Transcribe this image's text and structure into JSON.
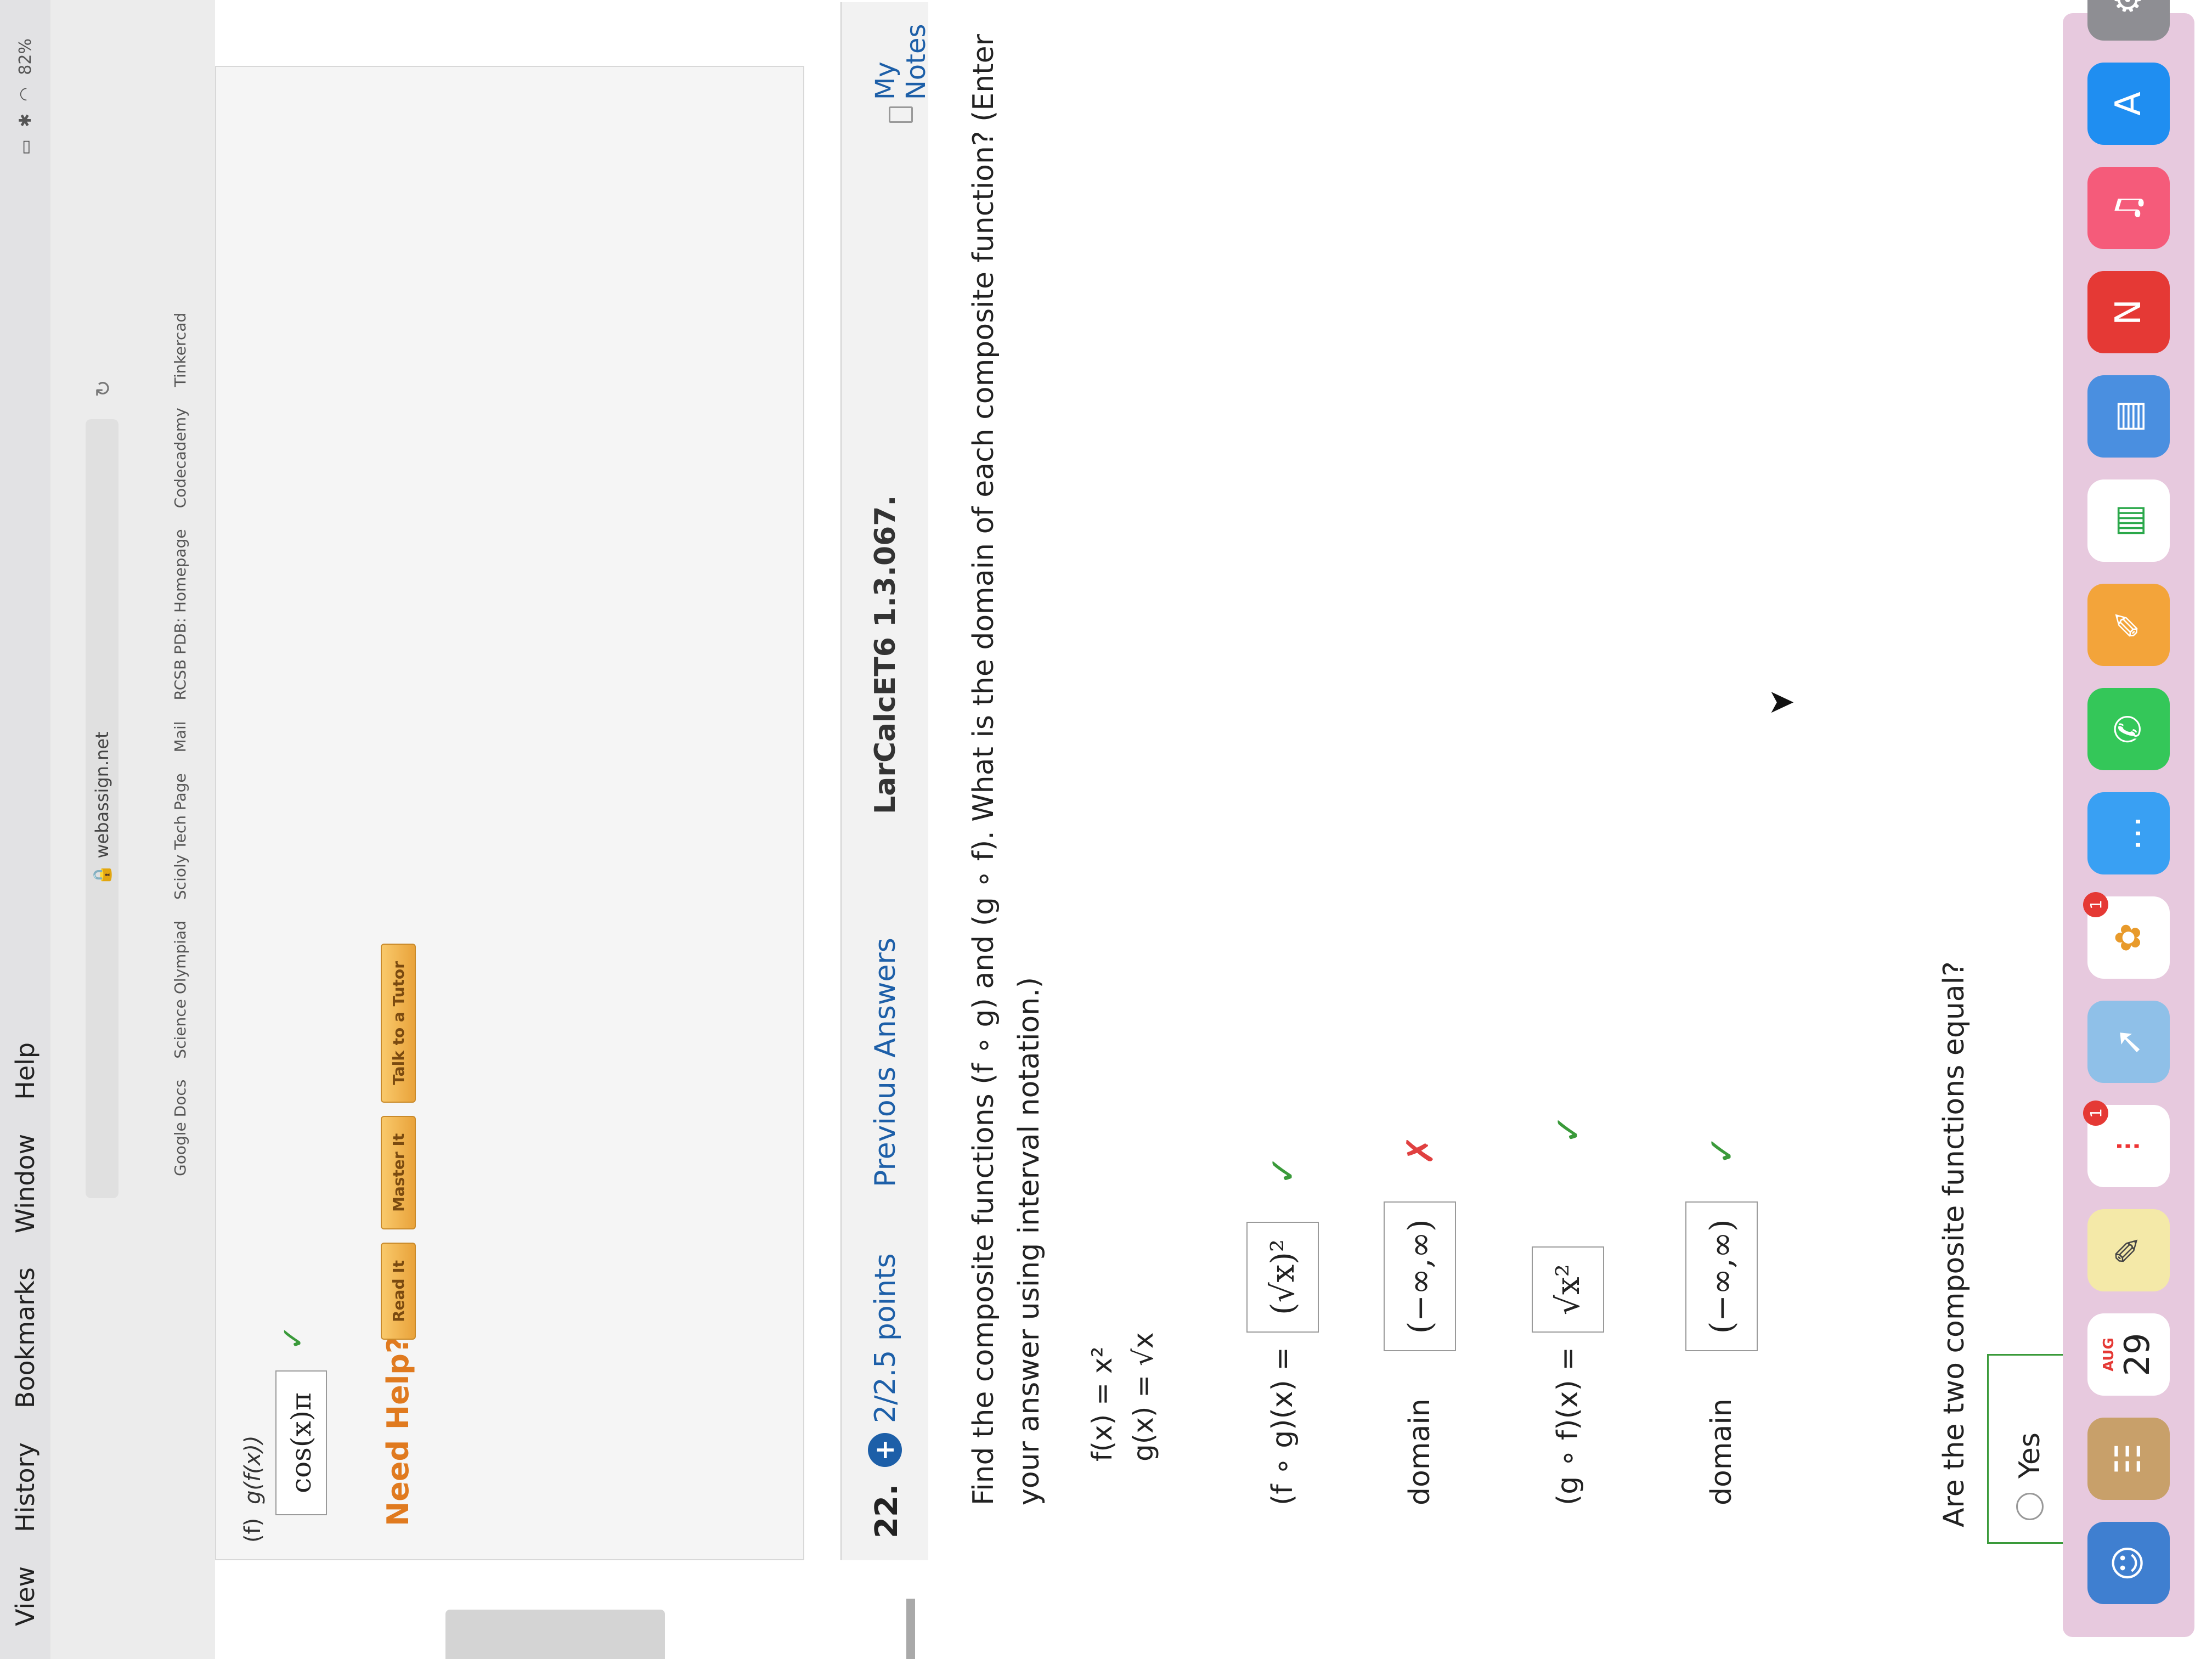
{
  "menubar": {
    "items": [
      "View",
      "History",
      "Bookmarks",
      "Window",
      "Help"
    ],
    "battery": "82%"
  },
  "browser": {
    "url": "webassign.net",
    "bookmarks": [
      "Google Docs",
      "Science Olympiad",
      "Scioly Tech Page",
      "Mail",
      "RCSB PDB: Homepage",
      "Codecademy",
      "Tinkercad"
    ]
  },
  "q21": {
    "part_label": "(f)",
    "part_expr": "g(f(x))",
    "answer": "cos(x)π",
    "check": "✓",
    "need_help": "Need Help?",
    "buttons": [
      "Read It",
      "Master It",
      "Talk to a Tutor"
    ]
  },
  "q22": {
    "number": "22.",
    "points": "2/2.5 points",
    "previous_answers": "Previous Answers",
    "code": "LarCalcET6 1.3.067.",
    "my_notes": "My Notes",
    "problem": "Find the composite functions (f ∘ g) and (g ∘ f). What is the domain of each composite function? (Enter your answer using interval notation.)",
    "f_def": "f(x) = x²",
    "g_def": "g(x) = √x",
    "fog_label": "(f ∘ g)(x) =",
    "fog_answer": "(√x)²",
    "fog_mark": "✓",
    "domain_label": "domain",
    "domain1_answer": "(−∞,∞)",
    "domain1_mark": "✗",
    "gof_label": "(g ∘ f)(x) =",
    "gof_answer": "√x²",
    "gof_mark": "✓",
    "domain2_answer": "(−∞,∞)",
    "domain2_mark": "✓",
    "equal_question": "Are the two composite functions equal?",
    "yes_label": "Yes"
  },
  "dock": {
    "calendar_month": "AUG",
    "calendar_day": "29",
    "reminders_badge": "1",
    "photos_badge": "1"
  }
}
